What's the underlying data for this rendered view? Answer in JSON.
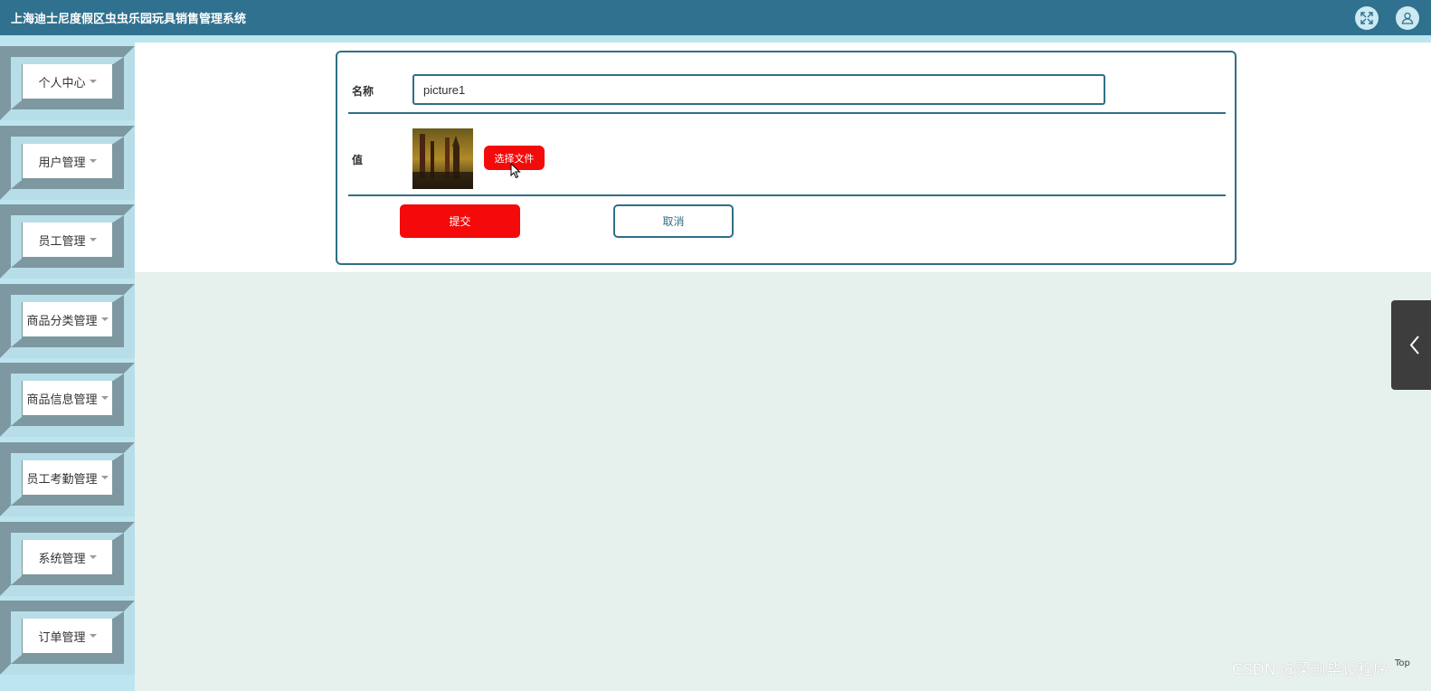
{
  "header": {
    "title": "上海迪士尼度假区虫虫乐园玩具销售管理系统",
    "fullscreen_icon": "expand-icon",
    "user_icon": "user-icon"
  },
  "sidebar": {
    "items": [
      {
        "label": "个人中心"
      },
      {
        "label": "用户管理"
      },
      {
        "label": "员工管理"
      },
      {
        "label": "商品分类管理"
      },
      {
        "label": "商品信息管理"
      },
      {
        "label": "员工考勤管理"
      },
      {
        "label": "系统管理"
      },
      {
        "label": "订单管理"
      }
    ]
  },
  "form": {
    "name_label": "名称",
    "name_value": "picture1",
    "value_label": "值",
    "choose_file_label": "选择文件",
    "submit_label": "提交",
    "cancel_label": "取消"
  },
  "footer": {
    "watermark": "CSDN @梁凯毕设程序",
    "top_label": "Top"
  },
  "colors": {
    "header": "#2f718e",
    "accent_red": "#f40a0a",
    "border_teal": "#2f6f87",
    "sidebar_bg": "#bde5f0",
    "page_bg": "#e6f0ec"
  }
}
